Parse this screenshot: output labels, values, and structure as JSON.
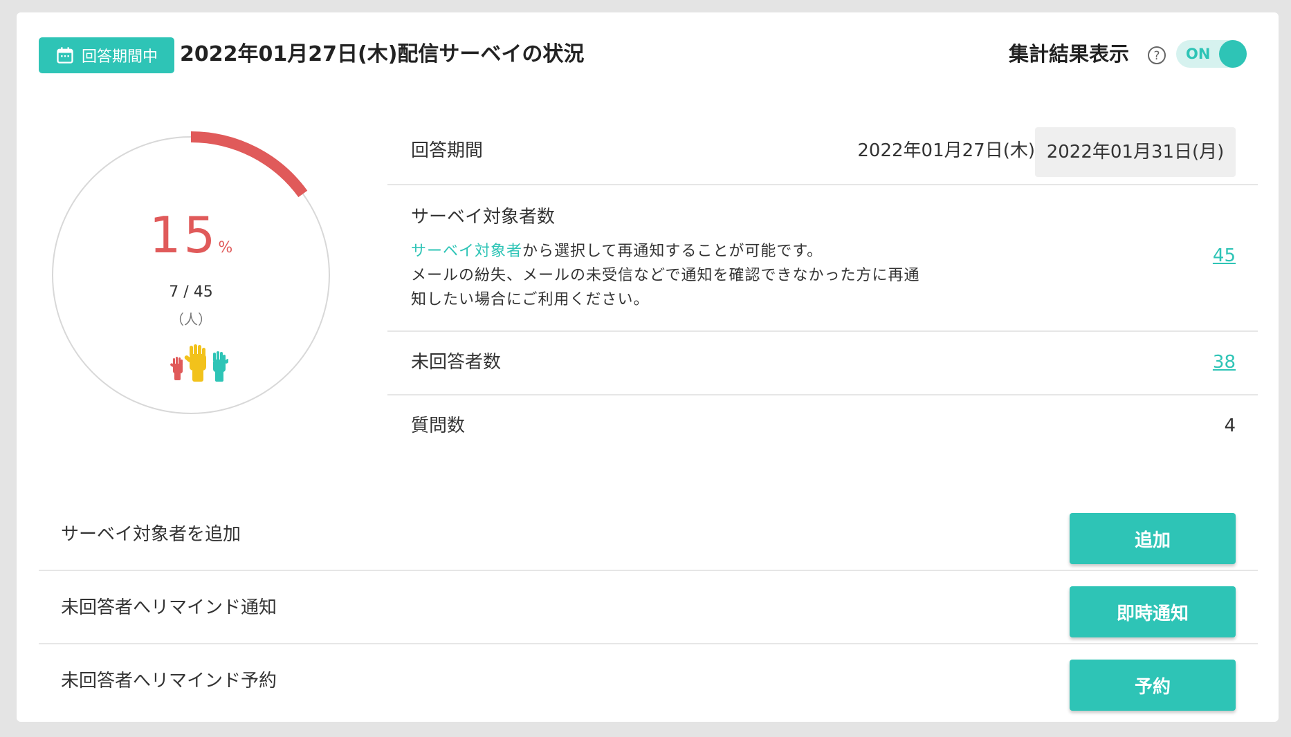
{
  "colors": {
    "accent": "#2ec4b6",
    "progress": "#e05a5a",
    "hand_red": "#e05a5a",
    "hand_yellow": "#f2c21b",
    "hand_teal": "#2ec4b6"
  },
  "header": {
    "status_badge": "回答期間中",
    "status_icon": "calendar-icon",
    "title": "2022年01月27日(木)配信サーベイの状況",
    "summary_label": "集計結果表示",
    "help_icon": "question-circle-icon",
    "toggle": {
      "label": "ON",
      "state": true
    }
  },
  "gauge": {
    "progress": 0.15,
    "percent": "15",
    "percent_unit": "%",
    "count": "7 / 45",
    "unit": "（人）",
    "icon": "raised-hands-icon"
  },
  "info": {
    "period": {
      "label": "回答期間",
      "start": "2022年01月27日(木)",
      "separator": "~",
      "end": "2022年01月31日(月)"
    },
    "target": {
      "label": "サーベイ対象者数",
      "desc_link": "サーベイ対象者",
      "desc_line1": "から選択して再通知することが可能です。",
      "desc_line2": "メールの紛失、メールの未受信などで通知を確認できなかった方に再通",
      "desc_line3": "知したい場合にご利用ください。",
      "value": "45"
    },
    "unanswered": {
      "label": "未回答者数",
      "value": "38"
    },
    "questions": {
      "label": "質問数",
      "value": "4"
    }
  },
  "actions": [
    {
      "label": "サーベイ対象者を追加",
      "button": "追加"
    },
    {
      "label": "未回答者へリマインド通知",
      "button": "即時通知"
    },
    {
      "label": "未回答者へリマインド予約",
      "button": "予約"
    }
  ]
}
